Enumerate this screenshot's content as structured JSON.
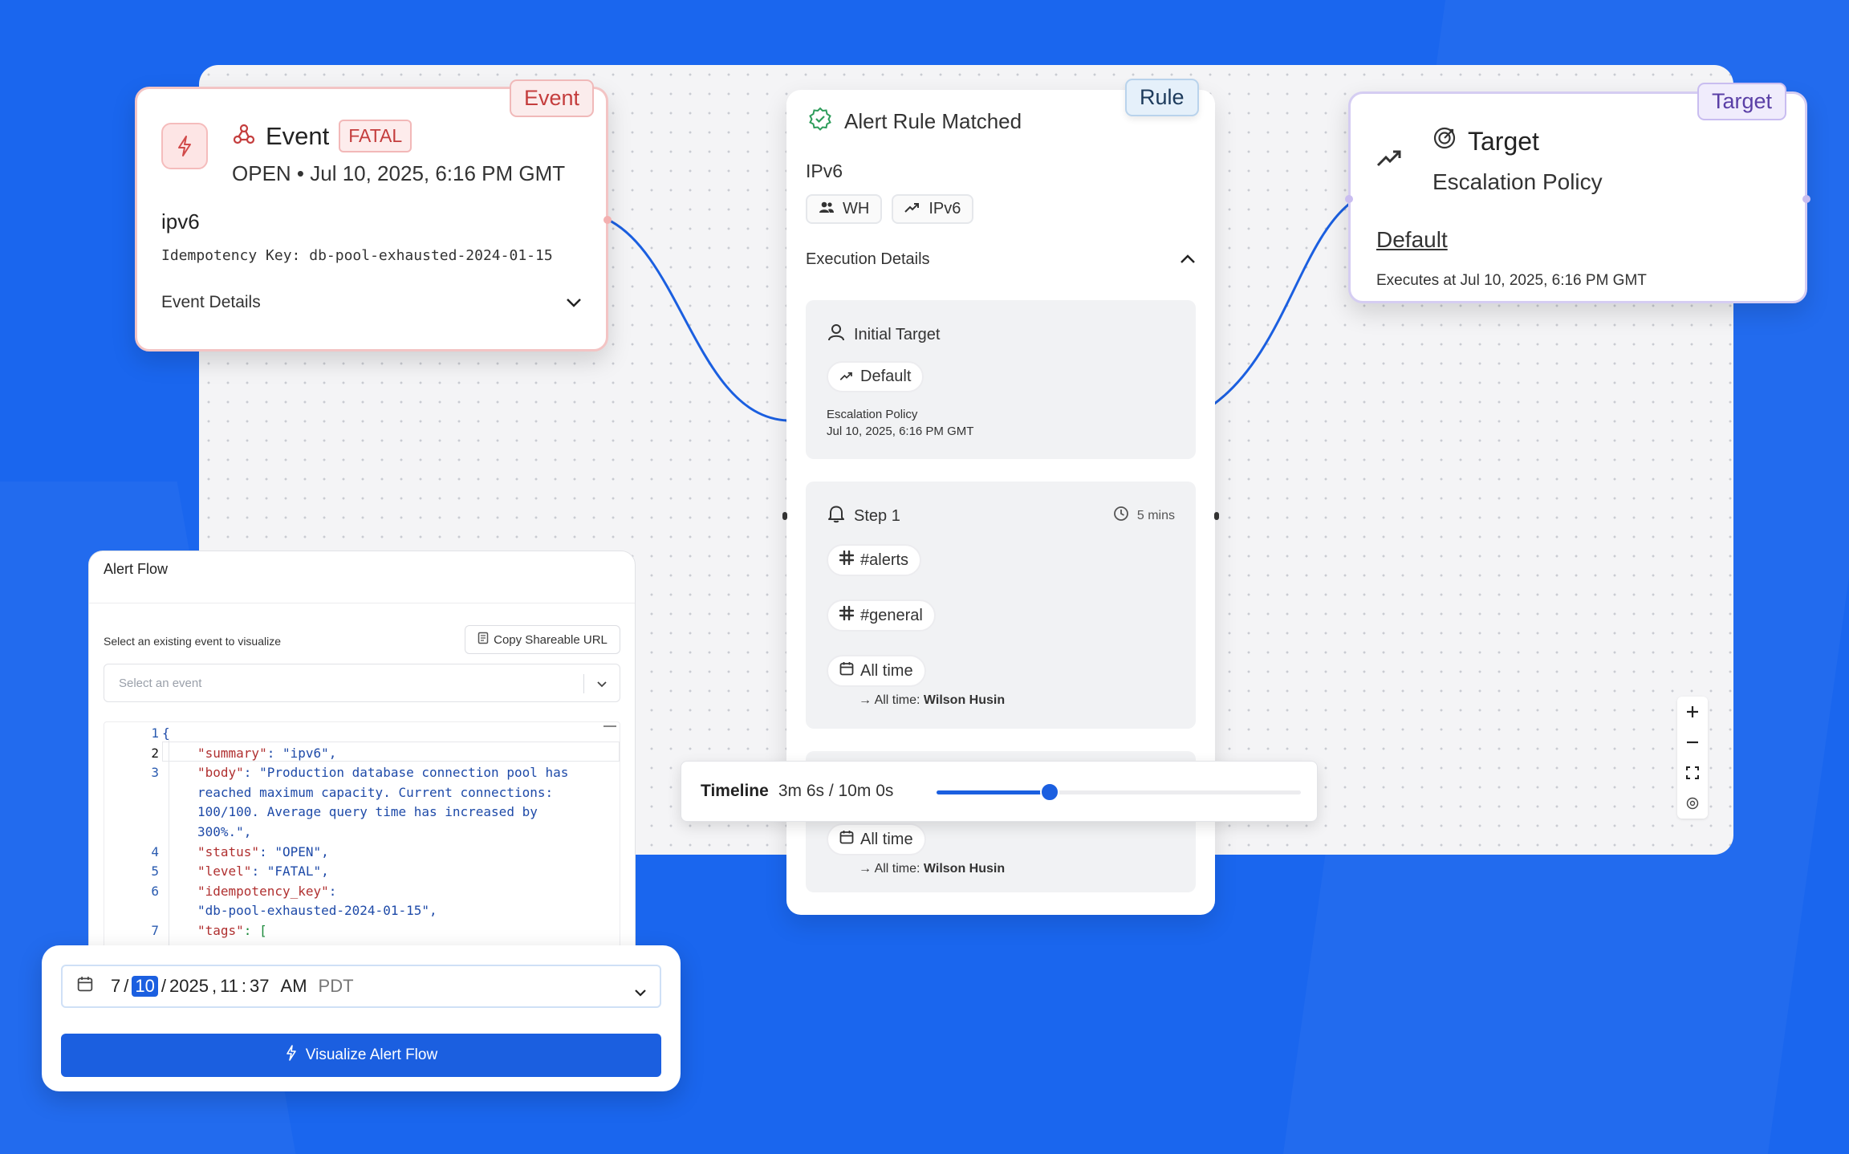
{
  "event_card": {
    "tag": "Event",
    "title": "Event",
    "severity": "FATAL",
    "status_line": "OPEN • Jul 10, 2025, 6:16 PM GMT",
    "name": "ipv6",
    "idempotency_key": "Idempotency Key: db-pool-exhausted-2024-01-15",
    "details_label": "Event Details"
  },
  "rule_card": {
    "tag": "Rule",
    "title": "Alert Rule Matched",
    "subtitle": "IPv6",
    "chips": [
      "WH",
      "IPv6"
    ],
    "execution_label": "Execution Details",
    "initial_target": {
      "label": "Initial Target",
      "chip": "Default",
      "type": "Escalation Policy",
      "time": "Jul 10, 2025, 6:16 PM GMT"
    },
    "step1": {
      "label": "Step 1",
      "duration": "5 mins",
      "channels": [
        "#alerts",
        "#general"
      ],
      "schedule": "All time",
      "arrow_prefix": "→ All time:",
      "person": "Wilson Husin"
    },
    "step2": {
      "schedule": "All time",
      "arrow_prefix": "→ All time:",
      "person": "Wilson Husin"
    }
  },
  "target_card": {
    "tag": "Target",
    "title": "Target",
    "subtitle": "Escalation Policy",
    "link": "Default",
    "executes": "Executes at Jul 10, 2025, 6:16 PM GMT"
  },
  "timeline": {
    "label": "Timeline",
    "value": "3m 6s / 10m 0s",
    "progress": 0.31
  },
  "alert_flow": {
    "title": "Alert Flow",
    "select_label": "Select an existing event to visualize",
    "copy_button": "Copy Shareable URL",
    "select_placeholder": "Select an event",
    "code_lines": [
      {
        "n": "1",
        "text": "{"
      },
      {
        "n": "2",
        "key": "\"summary\"",
        "text": ": \"ipv6\","
      },
      {
        "n": "3",
        "key": "\"body\"",
        "text": ": \"Production database connection pool has"
      },
      {
        "n": "",
        "text": "reached maximum capacity. Current connections:"
      },
      {
        "n": "",
        "text": "100/100. Average query time has increased by"
      },
      {
        "n": "",
        "text": "300%.\","
      },
      {
        "n": "4",
        "key": "\"status\"",
        "text": ": \"OPEN\","
      },
      {
        "n": "5",
        "key": "\"level\"",
        "text": ": \"FATAL\","
      },
      {
        "n": "6",
        "key": "\"idempotency_key\"",
        "text": ":"
      },
      {
        "n": "",
        "text": "\"db-pool-exhausted-2024-01-15\","
      },
      {
        "n": "7",
        "key": "\"tags\"",
        "text": ": ["
      }
    ]
  },
  "date_picker": {
    "month": "7",
    "day": "10",
    "year": "2025",
    "hour": "11",
    "minute": "37",
    "ampm": "AM",
    "timezone": "PDT",
    "sep_slash": "/",
    "sep_comma": ",",
    "sep_colon": ":"
  },
  "visualize_button": "Visualize Alert Flow",
  "colors": {
    "background": "#1a66ee",
    "primary": "#1b5fe0",
    "event_accent": "#c43d3d",
    "target_accent": "#5a3fa6",
    "rule_accent": "#1d3b5c"
  },
  "icons": [
    "bolt-icon",
    "webhook-icon",
    "check-badge-icon",
    "users-icon",
    "trend-up-icon",
    "chevron-up-icon",
    "chevron-down-icon",
    "user-icon",
    "bell-icon",
    "clock-icon",
    "slack-icon",
    "calendar-icon",
    "target-icon",
    "plus-icon",
    "minus-icon",
    "fullscreen-icon",
    "help-icon",
    "copy-icon",
    "sparkle-icon"
  ]
}
